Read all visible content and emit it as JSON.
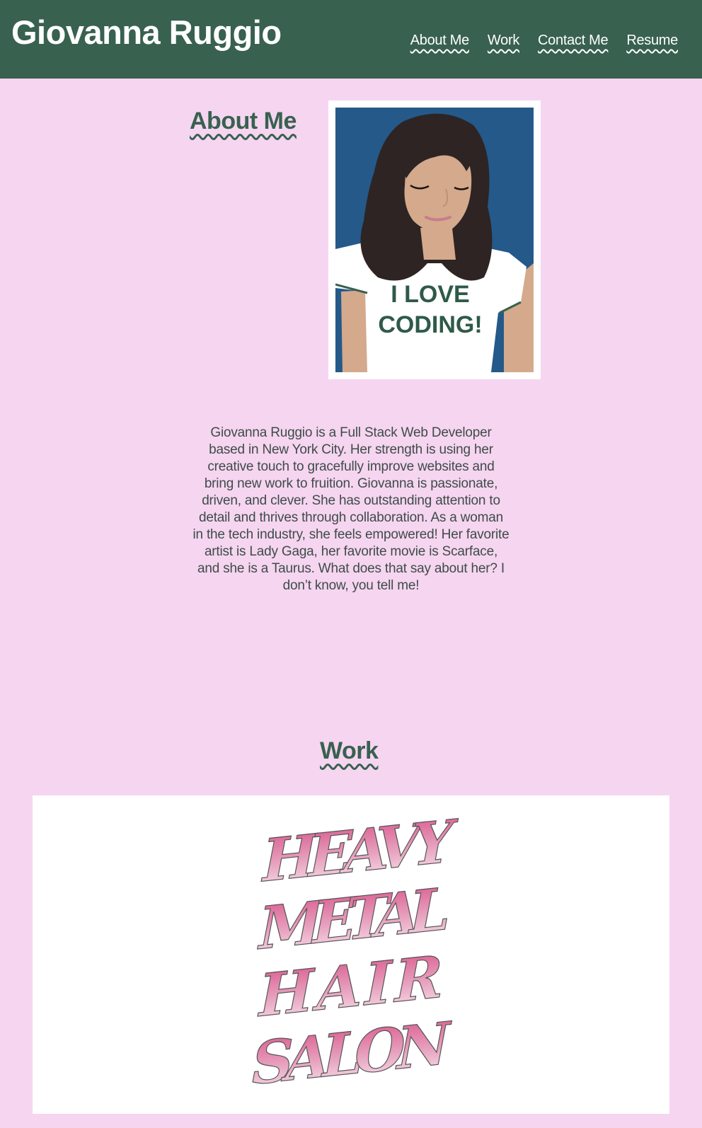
{
  "header": {
    "title": "Giovanna Ruggio",
    "nav": [
      {
        "label": "About Me"
      },
      {
        "label": "Work"
      },
      {
        "label": "Contact Me"
      },
      {
        "label": "Resume"
      }
    ],
    "background_color": "#386150"
  },
  "about": {
    "heading": "About Me",
    "portrait": {
      "shirt_text_line1": "I LOVE",
      "shirt_text_line2": "CODING!"
    },
    "bio": "Giovanna Ruggio is a Full Stack Web Developer based in New York City. Her strength is using her creative touch to gracefully improve websites and bring new work to fruition. Giovanna is passionate, driven, and clever. She has outstanding attention to detail and thrives through collaboration. As a woman in the tech industry, she feels empowered! Her favorite artist is Lady Gaga, her favorite movie is Scarface, and she is a Taurus. What does that say about her? I don’t know, you tell me!"
  },
  "work": {
    "heading": "Work",
    "project_logo": {
      "line1": "HEAVY",
      "line2": "METAL",
      "line3": "HAIR",
      "line4": "SALON"
    }
  },
  "colors": {
    "page_background": "#f6d5f1",
    "accent_green": "#386150",
    "logo_pink": "#d9548a"
  }
}
